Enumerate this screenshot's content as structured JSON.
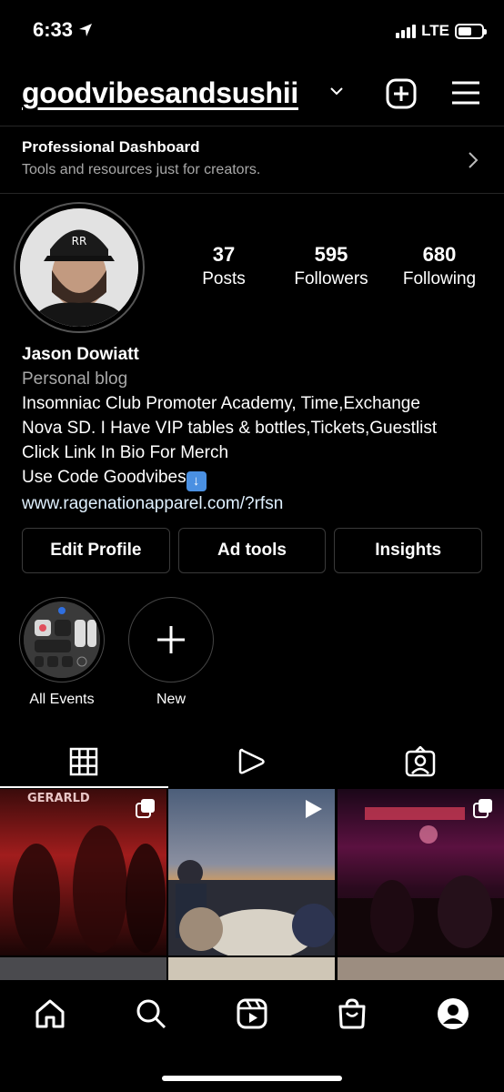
{
  "status_bar": {
    "time": "6:33",
    "network": "LTE",
    "icons": [
      "location-arrow-icon",
      "signal-bars-icon",
      "battery-icon"
    ],
    "battery_level": 0.6
  },
  "header": {
    "username": "goodvibesandsushii",
    "icons": [
      "chevron-down-icon",
      "add-post-icon",
      "hamburger-menu-icon"
    ]
  },
  "dashboard": {
    "title": "Professional Dashboard",
    "subtitle": "Tools and resources just for creators."
  },
  "profile": {
    "stats": [
      {
        "value": "37",
        "label": "Posts"
      },
      {
        "value": "595",
        "label": "Followers"
      },
      {
        "value": "680",
        "label": "Following"
      }
    ],
    "name": "Jason Dowiatt",
    "category": "Personal blog",
    "bio_lines": [
      "Insomniac Club Promoter Academy, Time,Exchange",
      "Nova SD. I Have VIP tables & bottles,Tickets,Guestlist",
      "Click Link In Bio For Merch",
      "Use Code Goodvibes"
    ],
    "link": "www.ragenationapparel.com/?rfsn"
  },
  "actions": {
    "edit_profile": "Edit Profile",
    "ad_tools": "Ad tools",
    "insights": "Insights"
  },
  "highlights": [
    {
      "label": "All Events"
    },
    {
      "label": "New"
    }
  ],
  "tabs": [
    "grid-icon",
    "reels-icon",
    "tagged-icon"
  ],
  "grid_tiles": [
    {
      "overlay_text": "GERARLD",
      "badge": "carousel-icon"
    },
    {
      "badge": "play-icon"
    },
    {
      "badge": "carousel-icon"
    }
  ],
  "bottom_nav": [
    "home-icon",
    "search-icon",
    "reels-nav-icon",
    "shop-icon",
    "profile-icon"
  ],
  "colors": {
    "background": "#000000",
    "text": "#ffffff",
    "secondary_text": "#a8a8a8",
    "border": "#363636"
  }
}
